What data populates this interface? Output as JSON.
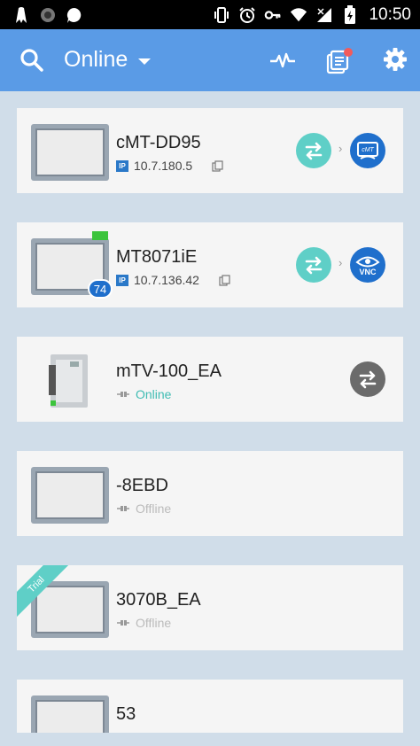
{
  "status_bar": {
    "time": "10:50"
  },
  "app_bar": {
    "title": "Online"
  },
  "devices": [
    {
      "name": "cMT-DD95",
      "ip": "10.7.180.5",
      "ip_label": "IP",
      "app": "cMT Viewer"
    },
    {
      "name": "MT8071iE",
      "ip": "10.7.136.42",
      "ip_label": "IP",
      "badge": "74",
      "app": "VNC"
    },
    {
      "name": "mTV-100_EA",
      "status": "Online"
    },
    {
      "name": "-8EBD",
      "status": "Offline"
    },
    {
      "name": "3070B_EA",
      "status": "Offline",
      "tag": "Trial"
    },
    {
      "name": "53"
    }
  ],
  "colors": {
    "appbar": "#5a9be6",
    "teal": "#5fcfc7",
    "blue": "#1f6fcc",
    "background": "#d0dde9"
  }
}
